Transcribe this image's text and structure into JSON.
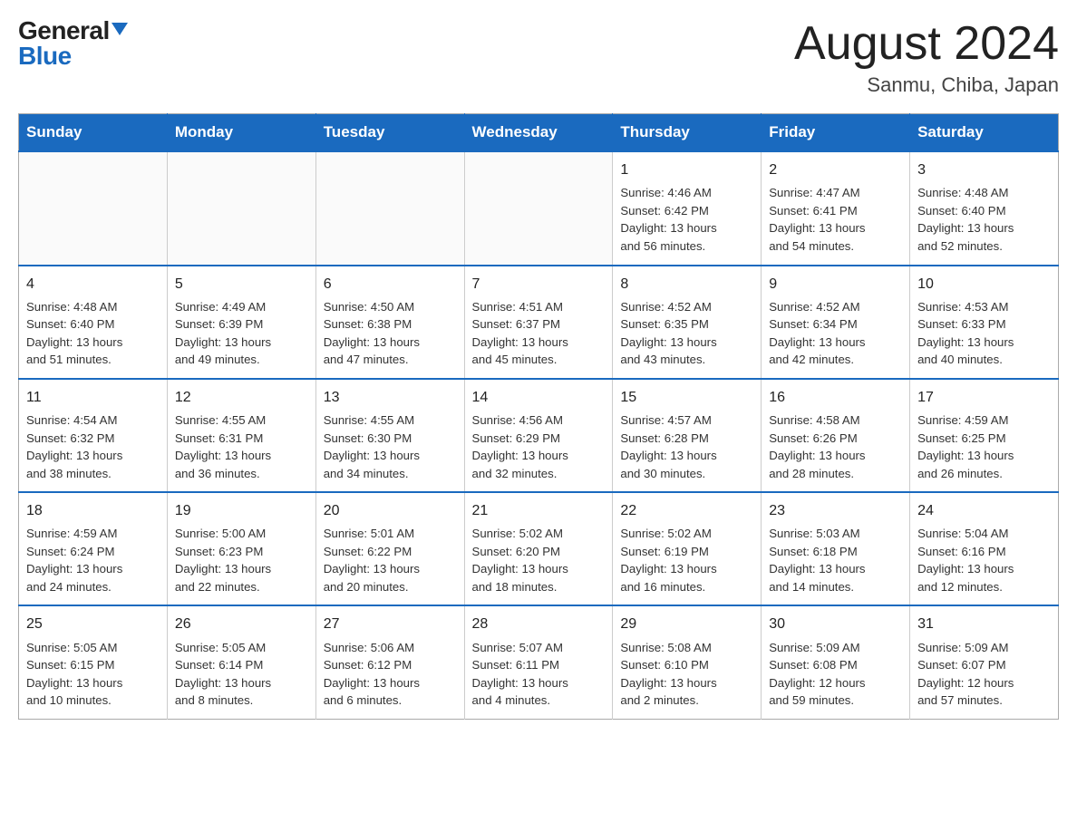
{
  "logo": {
    "general": "General",
    "blue": "Blue"
  },
  "title": {
    "month": "August 2024",
    "location": "Sanmu, Chiba, Japan"
  },
  "days_of_week": [
    "Sunday",
    "Monday",
    "Tuesday",
    "Wednesday",
    "Thursday",
    "Friday",
    "Saturday"
  ],
  "weeks": [
    [
      {
        "day": "",
        "info": ""
      },
      {
        "day": "",
        "info": ""
      },
      {
        "day": "",
        "info": ""
      },
      {
        "day": "",
        "info": ""
      },
      {
        "day": "1",
        "info": "Sunrise: 4:46 AM\nSunset: 6:42 PM\nDaylight: 13 hours\nand 56 minutes."
      },
      {
        "day": "2",
        "info": "Sunrise: 4:47 AM\nSunset: 6:41 PM\nDaylight: 13 hours\nand 54 minutes."
      },
      {
        "day": "3",
        "info": "Sunrise: 4:48 AM\nSunset: 6:40 PM\nDaylight: 13 hours\nand 52 minutes."
      }
    ],
    [
      {
        "day": "4",
        "info": "Sunrise: 4:48 AM\nSunset: 6:40 PM\nDaylight: 13 hours\nand 51 minutes."
      },
      {
        "day": "5",
        "info": "Sunrise: 4:49 AM\nSunset: 6:39 PM\nDaylight: 13 hours\nand 49 minutes."
      },
      {
        "day": "6",
        "info": "Sunrise: 4:50 AM\nSunset: 6:38 PM\nDaylight: 13 hours\nand 47 minutes."
      },
      {
        "day": "7",
        "info": "Sunrise: 4:51 AM\nSunset: 6:37 PM\nDaylight: 13 hours\nand 45 minutes."
      },
      {
        "day": "8",
        "info": "Sunrise: 4:52 AM\nSunset: 6:35 PM\nDaylight: 13 hours\nand 43 minutes."
      },
      {
        "day": "9",
        "info": "Sunrise: 4:52 AM\nSunset: 6:34 PM\nDaylight: 13 hours\nand 42 minutes."
      },
      {
        "day": "10",
        "info": "Sunrise: 4:53 AM\nSunset: 6:33 PM\nDaylight: 13 hours\nand 40 minutes."
      }
    ],
    [
      {
        "day": "11",
        "info": "Sunrise: 4:54 AM\nSunset: 6:32 PM\nDaylight: 13 hours\nand 38 minutes."
      },
      {
        "day": "12",
        "info": "Sunrise: 4:55 AM\nSunset: 6:31 PM\nDaylight: 13 hours\nand 36 minutes."
      },
      {
        "day": "13",
        "info": "Sunrise: 4:55 AM\nSunset: 6:30 PM\nDaylight: 13 hours\nand 34 minutes."
      },
      {
        "day": "14",
        "info": "Sunrise: 4:56 AM\nSunset: 6:29 PM\nDaylight: 13 hours\nand 32 minutes."
      },
      {
        "day": "15",
        "info": "Sunrise: 4:57 AM\nSunset: 6:28 PM\nDaylight: 13 hours\nand 30 minutes."
      },
      {
        "day": "16",
        "info": "Sunrise: 4:58 AM\nSunset: 6:26 PM\nDaylight: 13 hours\nand 28 minutes."
      },
      {
        "day": "17",
        "info": "Sunrise: 4:59 AM\nSunset: 6:25 PM\nDaylight: 13 hours\nand 26 minutes."
      }
    ],
    [
      {
        "day": "18",
        "info": "Sunrise: 4:59 AM\nSunset: 6:24 PM\nDaylight: 13 hours\nand 24 minutes."
      },
      {
        "day": "19",
        "info": "Sunrise: 5:00 AM\nSunset: 6:23 PM\nDaylight: 13 hours\nand 22 minutes."
      },
      {
        "day": "20",
        "info": "Sunrise: 5:01 AM\nSunset: 6:22 PM\nDaylight: 13 hours\nand 20 minutes."
      },
      {
        "day": "21",
        "info": "Sunrise: 5:02 AM\nSunset: 6:20 PM\nDaylight: 13 hours\nand 18 minutes."
      },
      {
        "day": "22",
        "info": "Sunrise: 5:02 AM\nSunset: 6:19 PM\nDaylight: 13 hours\nand 16 minutes."
      },
      {
        "day": "23",
        "info": "Sunrise: 5:03 AM\nSunset: 6:18 PM\nDaylight: 13 hours\nand 14 minutes."
      },
      {
        "day": "24",
        "info": "Sunrise: 5:04 AM\nSunset: 6:16 PM\nDaylight: 13 hours\nand 12 minutes."
      }
    ],
    [
      {
        "day": "25",
        "info": "Sunrise: 5:05 AM\nSunset: 6:15 PM\nDaylight: 13 hours\nand 10 minutes."
      },
      {
        "day": "26",
        "info": "Sunrise: 5:05 AM\nSunset: 6:14 PM\nDaylight: 13 hours\nand 8 minutes."
      },
      {
        "day": "27",
        "info": "Sunrise: 5:06 AM\nSunset: 6:12 PM\nDaylight: 13 hours\nand 6 minutes."
      },
      {
        "day": "28",
        "info": "Sunrise: 5:07 AM\nSunset: 6:11 PM\nDaylight: 13 hours\nand 4 minutes."
      },
      {
        "day": "29",
        "info": "Sunrise: 5:08 AM\nSunset: 6:10 PM\nDaylight: 13 hours\nand 2 minutes."
      },
      {
        "day": "30",
        "info": "Sunrise: 5:09 AM\nSunset: 6:08 PM\nDaylight: 12 hours\nand 59 minutes."
      },
      {
        "day": "31",
        "info": "Sunrise: 5:09 AM\nSunset: 6:07 PM\nDaylight: 12 hours\nand 57 minutes."
      }
    ]
  ],
  "colors": {
    "header_bg": "#1a6abf",
    "header_text": "#ffffff",
    "border": "#1a6abf"
  }
}
